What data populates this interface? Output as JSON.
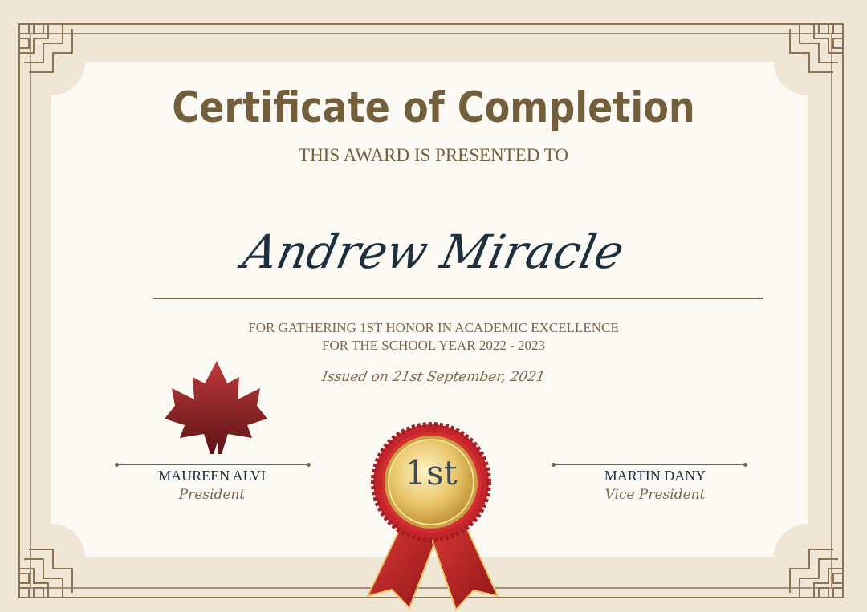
{
  "certificate": {
    "title": "Certificate of Completion",
    "subtitle": "THIS AWARD IS PRESENTED TO",
    "recipient": "Andrew Miracle",
    "reason_line1": "FOR GATHERING 1ST HONOR IN ACADEMIC EXCELLENCE",
    "reason_line2": "FOR THE SCHOOL YEAR 2022 - 2023",
    "issued": "Issued on 21st September, 2021"
  },
  "signatories": [
    {
      "name": "MAUREEN ALVI",
      "role": "President"
    },
    {
      "name": "MARTIN DANY",
      "role": "Vice President"
    }
  ],
  "medal": {
    "label": "1st"
  },
  "icons": {
    "emblem": "maple-leaf-icon",
    "award": "ribbon-medal-icon"
  },
  "colors": {
    "background": "#efe6d6",
    "paper": "#fbf9f4",
    "border": "#8a7453",
    "title": "#735f3c",
    "recipient": "#1e2f3d",
    "leaf": "#9e2a2c",
    "ribbon": "#c4262c",
    "medal_gold": "#d9ad45"
  }
}
